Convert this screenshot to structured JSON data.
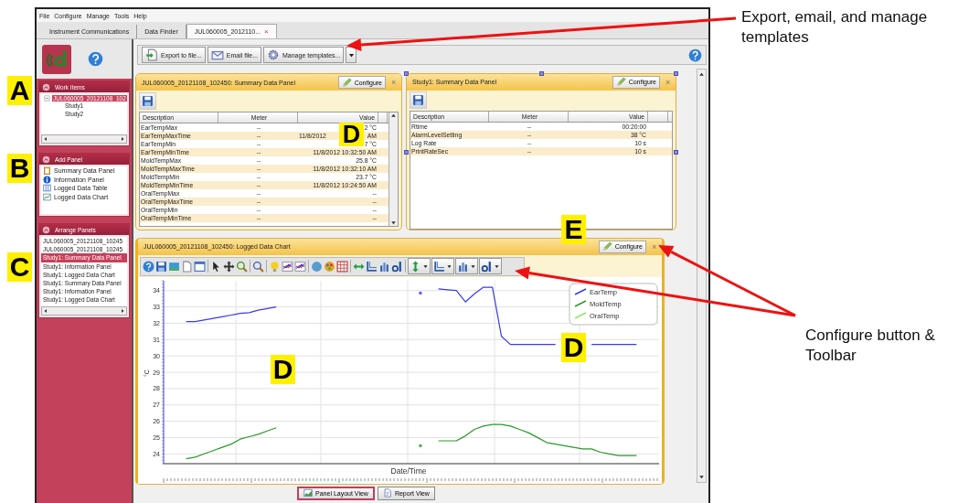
{
  "menu": [
    "File",
    "Configure",
    "Manage",
    "Tools",
    "Help"
  ],
  "tabs": [
    {
      "label": "Instrument Communications",
      "selected": false
    },
    {
      "label": "Data Finder",
      "selected": false
    },
    {
      "label": "JUL060005_2012110...",
      "selected": true,
      "close": "×"
    }
  ],
  "sidebar": {
    "sections": [
      {
        "title": "Work Items",
        "kind": "tree",
        "items": [
          {
            "label": "JUL060005_20121108_102",
            "selected": true,
            "expanded": true,
            "children": [
              {
                "label": "Study1",
                "selected": false
              },
              {
                "label": "Study2",
                "selected": false
              }
            ]
          }
        ]
      },
      {
        "title": "Add Panel",
        "kind": "palette",
        "items": [
          {
            "label": "Summary Data Panel",
            "kind": "summary"
          },
          {
            "label": "Information Panel",
            "kind": "information"
          },
          {
            "label": "Logged Data Table",
            "kind": "table"
          },
          {
            "label": "Logged Data Chart",
            "kind": "chart"
          }
        ]
      },
      {
        "title": "Arrange Panels",
        "kind": "list",
        "items": [
          {
            "label": "JUL060005_20121108_10245",
            "selected": false
          },
          {
            "label": "JUL060005_20121108_10245",
            "selected": false
          },
          {
            "label": "Study1: Summary Data Panel",
            "selected": true
          },
          {
            "label": "Study1: Information Panel",
            "selected": false
          },
          {
            "label": "Study1: Logged Data Chart",
            "selected": false
          },
          {
            "label": "Study1: Summary Data Panel",
            "selected": false
          },
          {
            "label": "Study1: Information Panel",
            "selected": false
          },
          {
            "label": "Study1: Logged Data Chart",
            "selected": false
          }
        ]
      }
    ]
  },
  "toolbar": {
    "buttons": [
      {
        "label": "Export to file...",
        "kind": "export"
      },
      {
        "label": "Email file...",
        "kind": "email"
      },
      {
        "label": "Manage templates...",
        "kind": "templates"
      }
    ]
  },
  "panels": [
    {
      "title": "JUL060005_20121108_102450: Summary Data Panel",
      "configure": "Configure",
      "close": "×",
      "selected": false,
      "columns": [
        "Description",
        "Meter",
        "Value"
      ],
      "rows": [
        {
          "description": "EarTempMax",
          "meter": "--",
          "value": "2 °C"
        },
        {
          "description": "EarTempMaxTime",
          "meter": "--",
          "value_start": "11/8/2012",
          "value": "AM"
        },
        {
          "description": "EarTempMin",
          "meter": "--",
          "value": "7 °C"
        },
        {
          "description": "EarTempMinTime",
          "meter": "--",
          "value": "11/8/2012 10:32:50 AM"
        },
        {
          "description": "MoldTempMax",
          "meter": "--",
          "value": "25.8 °C"
        },
        {
          "description": "MoldTempMaxTime",
          "meter": "--",
          "value": "11/8/2012 10:32:10 AM"
        },
        {
          "description": "MoldTempMin",
          "meter": "--",
          "value": "23.7 °C"
        },
        {
          "description": "MoldTempMinTime",
          "meter": "--",
          "value": "11/8/2012 10:24:50 AM"
        },
        {
          "description": "OralTempMax",
          "meter": "--",
          "value": "--"
        },
        {
          "description": "OralTempMaxTime",
          "meter": "--",
          "value": "--"
        },
        {
          "description": "OralTempMin",
          "meter": "--",
          "value": "--"
        },
        {
          "description": "OralTempMinTime",
          "meter": "--",
          "value": "--"
        }
      ]
    },
    {
      "title": "Study1: Summary Data Panel",
      "configure": "Configure",
      "close": "×",
      "selected": true,
      "columns": [
        "Description",
        "Meter",
        "Value"
      ],
      "rows": [
        {
          "description": "Rtime",
          "meter": "--",
          "value": "00:20:00"
        },
        {
          "description": "AlarmLevelSetting",
          "meter": "--",
          "value": "38 °C"
        },
        {
          "description": "Log Rate",
          "meter": "--",
          "value": "10 s"
        },
        {
          "description": "PrintRateSec",
          "meter": "--",
          "value": "10 s"
        }
      ]
    }
  ],
  "chart_panel": {
    "title": "JUL060005_20121108_102450: Logged Data Chart",
    "configure": "Configure",
    "close": "×",
    "chart_data": {
      "type": "line",
      "xlabel": "Date/Time",
      "ylabel": "°C",
      "grid": true,
      "legend": "upper right",
      "ylim": [
        23.4,
        34.6
      ],
      "yticks": [
        24,
        25,
        26,
        27,
        28,
        29,
        30,
        31,
        32,
        33,
        34
      ],
      "series": [
        {
          "name": "EarTemp",
          "color": "#3a3af0",
          "values": [
            null,
            null,
            32.1,
            32.1,
            32.2,
            32.3,
            32.4,
            32.5,
            32.6,
            32.65,
            32.8,
            32.9,
            33.0,
            null,
            null,
            null,
            null,
            null,
            null,
            null,
            null,
            null,
            null,
            null,
            null,
            null,
            null,
            null,
            33.85,
            null,
            34.1,
            34.05,
            34.0,
            33.3,
            33.8,
            34.2,
            34.2,
            31.2,
            30.7,
            30.7,
            30.7,
            30.7,
            30.7,
            30.7,
            null,
            null,
            null,
            30.7,
            30.7,
            30.7,
            30.7,
            30.7,
            30.7,
            null,
            null
          ]
        },
        {
          "name": "MoldTemp",
          "color": "#2a9a2a",
          "values": [
            null,
            null,
            23.7,
            23.8,
            24.0,
            24.2,
            24.4,
            24.6,
            24.9,
            25.05,
            25.2,
            25.4,
            25.6,
            null,
            null,
            null,
            null,
            null,
            null,
            null,
            null,
            null,
            null,
            null,
            null,
            null,
            null,
            null,
            24.5,
            null,
            24.8,
            24.8,
            24.8,
            25.1,
            25.5,
            25.7,
            25.8,
            25.8,
            25.7,
            25.5,
            25.3,
            25.0,
            24.7,
            24.6,
            24.5,
            24.4,
            24.3,
            24.3,
            24.1,
            24.0,
            23.9,
            23.9,
            23.9,
            null,
            null
          ]
        },
        {
          "name": "OralTemp",
          "color": "#8ee860"
        }
      ]
    }
  },
  "view_buttons": [
    {
      "label": "Panel Layout View",
      "selected": true,
      "kind": "layout"
    },
    {
      "label": "Report View",
      "selected": false,
      "kind": "report"
    }
  ],
  "annotations": {
    "marks": [
      "A",
      "B",
      "C",
      "D",
      "E",
      "D",
      "D"
    ],
    "callouts": [
      "Export, email, and manage templates",
      "Configure button & Toolbar"
    ]
  }
}
